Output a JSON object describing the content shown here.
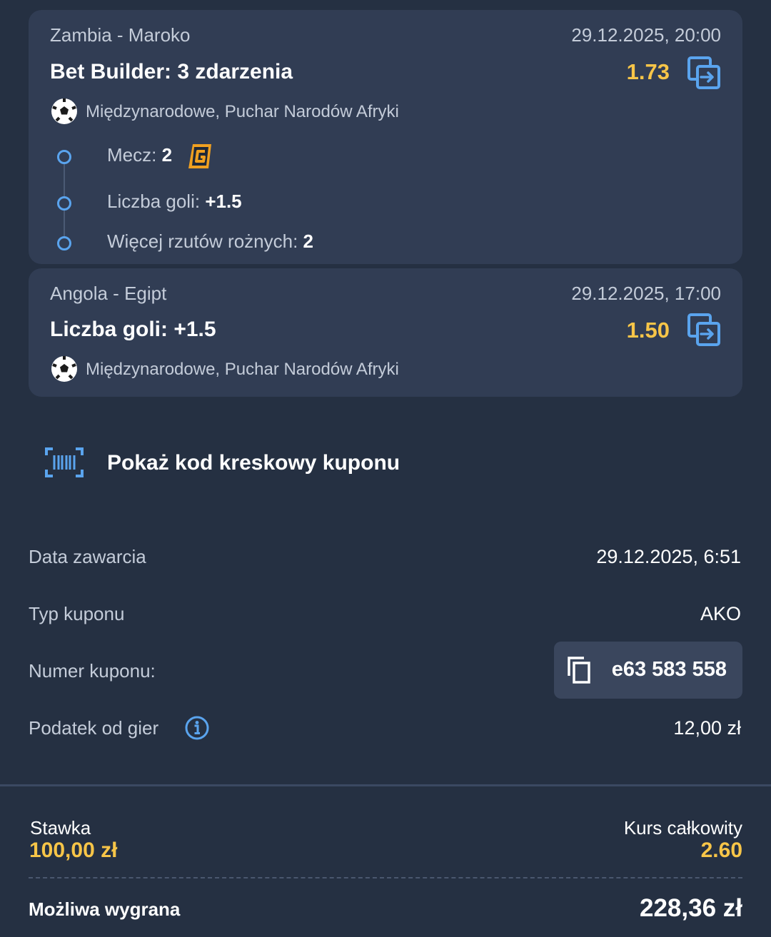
{
  "bets": [
    {
      "match": "Zambia - Maroko",
      "datetime": "29.12.2025, 20:00",
      "title": "Bet Builder: 3 zdarzenia",
      "odds": "1.73",
      "league": "Międzynarodowe, Puchar Narodów Afryki",
      "selections": [
        {
          "label": "Mecz: ",
          "value": "2"
        },
        {
          "label": "Liczba goli: ",
          "value": "+1.5"
        },
        {
          "label": "Więcej rzutów rożnych: ",
          "value": "2"
        }
      ]
    },
    {
      "match": "Angola - Egipt",
      "datetime": "29.12.2025, 17:00",
      "title": "Liczba goli: +1.5",
      "odds": "1.50",
      "league": "Międzynarodowe, Puchar Narodów Afryki"
    }
  ],
  "barcode_label": "Pokaż kod kreskowy kuponu",
  "details": {
    "date_label": "Data zawarcia",
    "date_value": "29.12.2025, 6:51",
    "type_label": "Typ kuponu",
    "type_value": "AKO",
    "number_label": "Numer kuponu:",
    "number_value": "e63 583 558",
    "tax_label": "Podatek od gier",
    "tax_value": "12,00 zł"
  },
  "summary": {
    "stake_label": "Stawka",
    "stake_value": "100,00 zł",
    "odds_label": "Kurs całkowity",
    "odds_value": "2.60",
    "win_label": "Możliwa wygrana",
    "win_value": "228,36 zł"
  },
  "icons": {
    "copy_bet": "copy-to-betslip-icon",
    "ball": "soccer-ball-icon",
    "boost": "boost-g-icon",
    "barcode": "barcode-icon",
    "copy": "copy-icon",
    "info": "info-icon"
  },
  "colors": {
    "background": "#253042",
    "card": "#313d54",
    "accent_yellow": "#f7c548",
    "accent_blue": "#5aa4ee",
    "boost_orange": "#f0a020"
  }
}
